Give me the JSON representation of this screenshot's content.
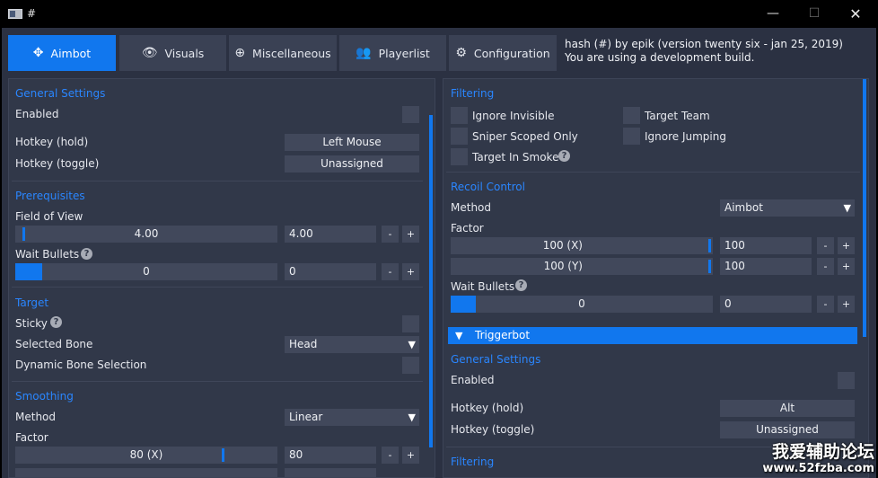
{
  "window": {
    "title": "#",
    "minimize": "—",
    "maximize": "☐",
    "close": "✕"
  },
  "tabs": [
    {
      "label": "Aimbot",
      "icon": "crosshair-icon",
      "glyph": "✥"
    },
    {
      "label": "Visuals",
      "icon": "eye-icon",
      "glyph": "👁"
    },
    {
      "label": "Miscellaneous",
      "icon": "plus-circle-icon",
      "glyph": "⊕"
    },
    {
      "label": "Playerlist",
      "icon": "users-icon",
      "glyph": "👥"
    },
    {
      "label": "Configuration",
      "icon": "gears-icon",
      "glyph": "⚙"
    }
  ],
  "info": {
    "line1": "hash (#) by epik (version twenty six - jan 25, 2019)",
    "line2": "You are using a development build."
  },
  "left": {
    "general": {
      "title": "General Settings",
      "enabled": "Enabled",
      "hotkey_hold": "Hotkey (hold)",
      "hotkey_hold_value": "Left Mouse",
      "hotkey_toggle": "Hotkey (toggle)",
      "hotkey_toggle_value": "Unassigned"
    },
    "prereq": {
      "title": "Prerequisites",
      "fov": "Field of View",
      "fov_value": "4.00",
      "fov_box": "4.00",
      "wait_bullets": "Wait Bullets",
      "wait_value": "0",
      "wait_box": "0"
    },
    "target": {
      "title": "Target",
      "sticky": "Sticky",
      "selected_bone": "Selected Bone",
      "selected_bone_value": "Head",
      "dynamic_bone": "Dynamic Bone Selection"
    },
    "smoothing": {
      "title": "Smoothing",
      "method": "Method",
      "method_value": "Linear",
      "factor": "Factor",
      "factor_x": "80 (X)",
      "factor_x_box": "80"
    },
    "minus": "-",
    "plus": "+",
    "help": "?"
  },
  "right": {
    "filtering": {
      "title": "Filtering",
      "ignore_invisible": "Ignore Invisible",
      "target_team": "Target Team",
      "sniper_scoped": "Sniper Scoped Only",
      "ignore_jumping": "Ignore Jumping",
      "target_smoke": "Target In Smoke"
    },
    "recoil": {
      "title": "Recoil Control",
      "method": "Method",
      "method_value": "Aimbot",
      "factor": "Factor",
      "factor_x": "100 (X)",
      "factor_x_box": "100",
      "factor_y": "100 (Y)",
      "factor_y_box": "100",
      "wait_bullets": "Wait Bullets",
      "wait_value": "0",
      "wait_box": "0"
    },
    "triggerbot": {
      "header": "Triggerbot",
      "general_title": "General Settings",
      "enabled": "Enabled",
      "hotkey_hold": "Hotkey (hold)",
      "hotkey_hold_value": "Alt",
      "hotkey_toggle": "Hotkey (toggle)",
      "hotkey_toggle_value": "Unassigned",
      "filtering_title": "Filtering"
    },
    "minus": "-",
    "plus": "+",
    "help": "?"
  },
  "watermark": {
    "cn": "我爱辅助论坛",
    "url": "www.52fzba.com"
  },
  "colors": {
    "accent": "#1177ee",
    "panel": "#313849",
    "control": "#41485b",
    "section": "#2a86ff"
  }
}
